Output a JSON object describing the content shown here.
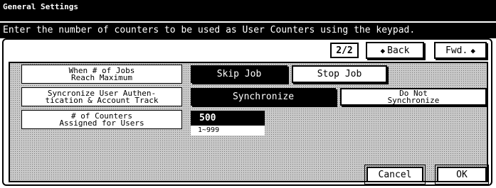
{
  "header": {
    "title": "General Settings",
    "instruction": "Enter the number of counters to be used as User Counters using the keypad."
  },
  "nav": {
    "page_indicator": "2/2",
    "back_label": "Back",
    "back_icon": "◆",
    "fwd_label": "Fwd.",
    "fwd_icon": "◆"
  },
  "settings": {
    "jobs_max_label_1": "When # of Jobs",
    "jobs_max_label_2": "Reach Maximum",
    "skip_job": "Skip Job",
    "stop_job": "Stop Job",
    "sync_label_1": "Syncronize User Authen-",
    "sync_label_2": "tication & Account Track",
    "synchronize": "Synchronize",
    "do_not_sync_1": "Do Not",
    "do_not_sync_2": "Synchronize",
    "counters_label_1": "# of Counters",
    "counters_label_2": "Assigned for Users",
    "counters_value": "500",
    "counters_range": "1~999"
  },
  "footer": {
    "cancel_label": "Cancel",
    "ok_label": "OK"
  },
  "colors": {
    "selected": "#000000",
    "panel": "#c9c9c9"
  }
}
